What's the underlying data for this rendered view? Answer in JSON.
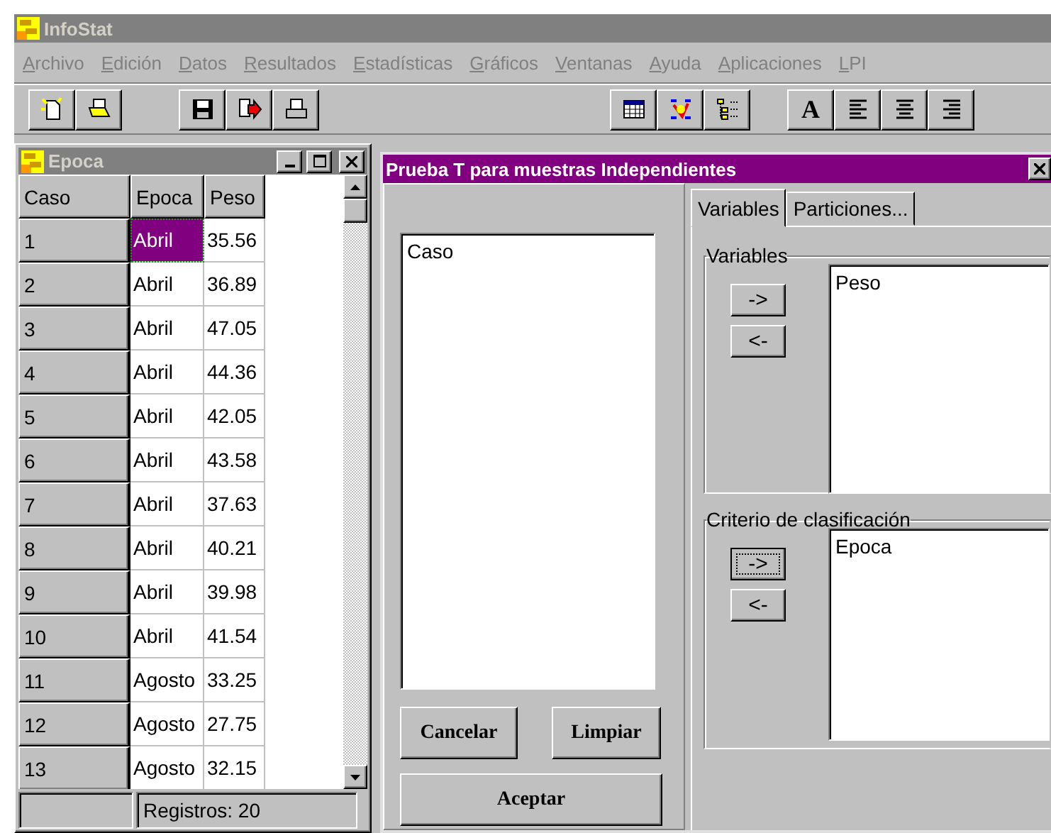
{
  "app": {
    "title": "InfoStat"
  },
  "menu": [
    "Archivo",
    "Edición",
    "Datos",
    "Resultados",
    "Estadísticas",
    "Gráficos",
    "Ventanas",
    "Ayuda",
    "Aplicaciones",
    "LPI"
  ],
  "toolbar": {
    "font_button": "A"
  },
  "data_window": {
    "title": "Epoca",
    "columns": [
      "Caso",
      "Epoca",
      "Peso"
    ],
    "rows": [
      {
        "case": "1",
        "epoca": "Abril",
        "peso": "35.56",
        "selected": true
      },
      {
        "case": "2",
        "epoca": "Abril",
        "peso": "36.89",
        "selected": false
      },
      {
        "case": "3",
        "epoca": "Abril",
        "peso": "47.05",
        "selected": false
      },
      {
        "case": "4",
        "epoca": "Abril",
        "peso": "44.36",
        "selected": false
      },
      {
        "case": "5",
        "epoca": "Abril",
        "peso": "42.05",
        "selected": false
      },
      {
        "case": "6",
        "epoca": "Abril",
        "peso": "43.58",
        "selected": false
      },
      {
        "case": "7",
        "epoca": "Abril",
        "peso": "37.63",
        "selected": false
      },
      {
        "case": "8",
        "epoca": "Abril",
        "peso": "40.21",
        "selected": false
      },
      {
        "case": "9",
        "epoca": "Abril",
        "peso": "39.98",
        "selected": false
      },
      {
        "case": "10",
        "epoca": "Abril",
        "peso": "41.54",
        "selected": false
      },
      {
        "case": "11",
        "epoca": "Agosto",
        "peso": "33.25",
        "selected": false
      },
      {
        "case": "12",
        "epoca": "Agosto",
        "peso": "27.75",
        "selected": false
      },
      {
        "case": "13",
        "epoca": "Agosto",
        "peso": "32.15",
        "selected": false
      }
    ],
    "status": "Registros: 20"
  },
  "dialog": {
    "title": "Prueba T para muestras Independientes",
    "available": [
      "Caso"
    ],
    "buttons": {
      "cancel": "Cancelar",
      "clear": "Limpiar",
      "accept": "Aceptar"
    },
    "tabs": [
      {
        "label": "Variables",
        "selected": true
      },
      {
        "label": "Particiones...",
        "selected": false
      }
    ],
    "groups": [
      {
        "title": "Variables",
        "items": [
          "Peso"
        ],
        "add": {
          "label": "->",
          "focused": false
        },
        "remove": {
          "label": "<-",
          "focused": false
        }
      },
      {
        "title": "Criterio de clasificación",
        "items": [
          "Epoca"
        ],
        "add": {
          "label": "->",
          "focused": true
        },
        "remove": {
          "label": "<-",
          "focused": false
        }
      }
    ]
  }
}
